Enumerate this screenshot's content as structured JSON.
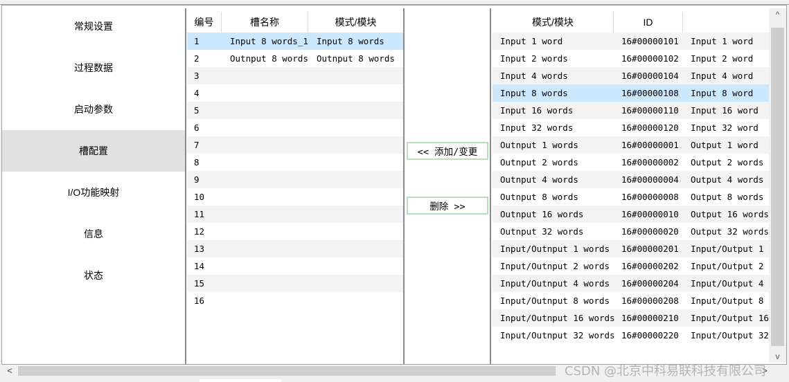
{
  "nav": {
    "items": [
      {
        "label": "常规设置",
        "selected": false
      },
      {
        "label": "过程数据",
        "selected": false
      },
      {
        "label": "启动参数",
        "selected": false
      },
      {
        "label": "槽配置",
        "selected": true
      },
      {
        "label": "I/O功能映射",
        "selected": false
      },
      {
        "label": "信息",
        "selected": false
      },
      {
        "label": "状态",
        "selected": false
      }
    ]
  },
  "slot_table": {
    "headers": [
      "编号",
      "槽名称",
      "模式/模块"
    ],
    "rows": [
      [
        "1",
        "Input 8 words_1",
        "Input 8 words"
      ],
      [
        "2",
        "Outnput 8 words",
        "Outnput 8 words"
      ],
      [
        "3",
        "",
        ""
      ],
      [
        "4",
        "",
        ""
      ],
      [
        "5",
        "",
        ""
      ],
      [
        "6",
        "",
        ""
      ],
      [
        "7",
        "",
        ""
      ],
      [
        "8",
        "",
        ""
      ],
      [
        "9",
        "",
        ""
      ],
      [
        "10",
        "",
        ""
      ],
      [
        "11",
        "",
        ""
      ],
      [
        "12",
        "",
        ""
      ],
      [
        "13",
        "",
        ""
      ],
      [
        "14",
        "",
        ""
      ],
      [
        "15",
        "",
        ""
      ],
      [
        "16",
        "",
        ""
      ]
    ],
    "selected_row": 0
  },
  "buttons": {
    "add_change": "<< 添加/变更",
    "delete": "删除 >>"
  },
  "module_table": {
    "headers": [
      "模式/模块",
      "ID",
      ""
    ],
    "rows": [
      [
        "Input 1 word",
        "16#00000101",
        "Input 1 word"
      ],
      [
        "Input 2 words",
        "16#00000102",
        "Input 2 word"
      ],
      [
        "Input 4 words",
        "16#00000104",
        "Input 4 word"
      ],
      [
        "Input 8 words",
        "16#00000108",
        "Input 8 word"
      ],
      [
        "Input 16 words",
        "16#00000110",
        "Input 16 word"
      ],
      [
        "Input 32 words",
        "16#00000120",
        "Input 32 word"
      ],
      [
        "Outnput 1 words",
        "16#00000001",
        "Output 1 word"
      ],
      [
        "Outnput 2 words",
        "16#00000002",
        "Output 2 words"
      ],
      [
        "Outnput 4 words",
        "16#00000004",
        "Output 4 words"
      ],
      [
        "Outnput 8 words",
        "16#00000008",
        "Output 8 words"
      ],
      [
        "Outnput 16 words",
        "16#00000010",
        "Output 16 words"
      ],
      [
        "Outnput 32 words",
        "16#00000020",
        "Output 32 words"
      ],
      [
        "Input/Outnput 1 words",
        "16#00000201",
        "Input/Output 1"
      ],
      [
        "Input/Outnput 2 words",
        "16#00000202",
        "Input/Output 2"
      ],
      [
        "Input/Outnput 4 words",
        "16#00000204",
        "Input/Output 4"
      ],
      [
        "Input/Outnput 8 words",
        "16#00000208",
        "Input/Output 8"
      ],
      [
        "Input/Outnput 16 words",
        "16#00000210",
        "Input/Output 16"
      ],
      [
        "Input/Outnput 32 words",
        "16#00000220",
        "Input/Output 32"
      ]
    ],
    "selected_row": 3
  },
  "scrollbars": {
    "up_icon": "^",
    "down_icon": "v",
    "left_icon": "<",
    "right_icon": ">"
  },
  "watermark": "CSDN @北京中科易联科技有限公司",
  "colors": {
    "selection": "#cce8ff",
    "nav_selected": "#e1e1e1",
    "button_border": "#b6e0b6"
  }
}
